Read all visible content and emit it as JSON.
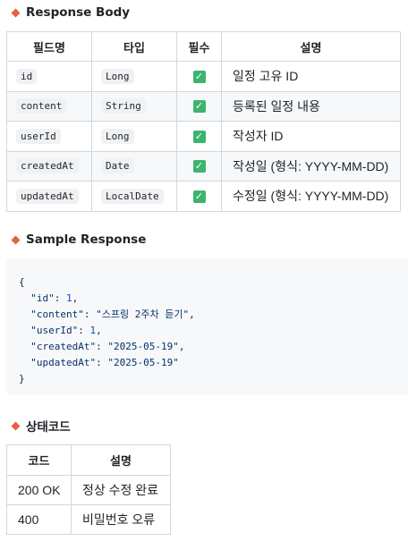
{
  "response_body": {
    "title": "Response Body",
    "headers": [
      "필드명",
      "타입",
      "필수",
      "설명"
    ],
    "rows": [
      {
        "field": "id",
        "type": "Long",
        "required": "✓",
        "desc": "일정 고유 ID"
      },
      {
        "field": "content",
        "type": "String",
        "required": "✓",
        "desc": "등록된 일정 내용"
      },
      {
        "field": "userId",
        "type": "Long",
        "required": "✓",
        "desc": "작성자 ID"
      },
      {
        "field": "createdAt",
        "type": "Date",
        "required": "✓",
        "desc": "작성일 (형식: YYYY-MM-DD)"
      },
      {
        "field": "updatedAt",
        "type": "LocalDate",
        "required": "✓",
        "desc": "수정일 (형식: YYYY-MM-DD)"
      }
    ]
  },
  "sample": {
    "title": "Sample Response",
    "open": "{",
    "close": "}",
    "lines": [
      {
        "key": "\"id\"",
        "value": "1",
        "kind": "n",
        "comma": ","
      },
      {
        "key": "\"content\"",
        "value": "\"스프링 2주차 듣기\"",
        "kind": "s",
        "comma": ","
      },
      {
        "key": "\"userId\"",
        "value": "1",
        "kind": "n",
        "comma": ","
      },
      {
        "key": "\"createdAt\"",
        "value": "\"2025-05-19\"",
        "kind": "s",
        "comma": ","
      },
      {
        "key": "\"updatedAt\"",
        "value": "\"2025-05-19\"",
        "kind": "s",
        "comma": ""
      }
    ]
  },
  "status": {
    "title": "상태코드",
    "headers": [
      "코드",
      "설명"
    ],
    "rows": [
      {
        "code": "200 OK",
        "desc": "정상 수정 완료"
      },
      {
        "code": "400",
        "desc": "비밀번호 오류"
      }
    ]
  },
  "colors": {
    "accent": "#e8613c",
    "check": "#3db46d"
  }
}
